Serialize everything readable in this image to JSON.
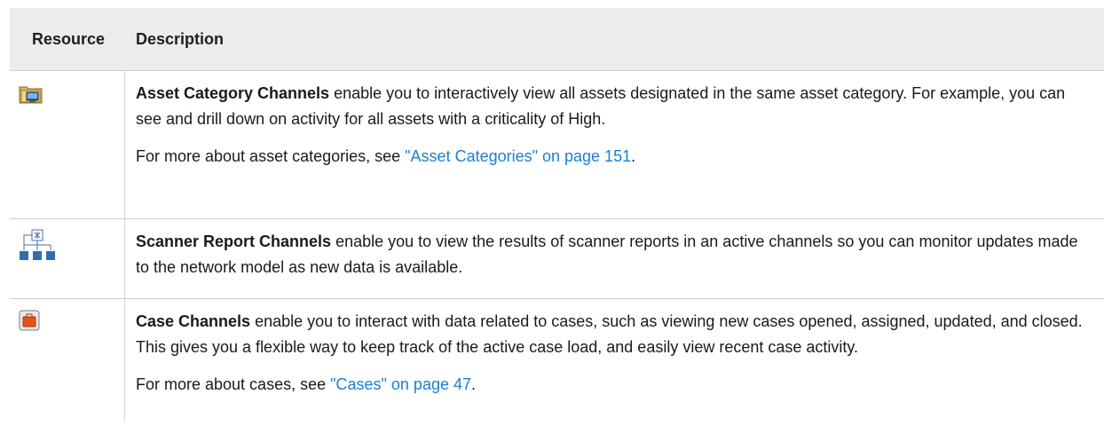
{
  "header": {
    "resource": "Resource",
    "description": "Description"
  },
  "rows": [
    {
      "icon": "asset-category-folder-icon",
      "title": "Asset Category Channels",
      "text": " enable you to interactively view all assets designated in the same asset category. For example, you can see and drill down on activity for all assets with a criticality of High.",
      "more_prefix": "For more about asset categories, see ",
      "link": "\"Asset Categories\" on page 151",
      "more_suffix": "."
    },
    {
      "icon": "scanner-report-icon",
      "title": "Scanner Report Channels",
      "text": " enable you to view the results of scanner reports in an active channels so you can monitor updates made to the network model as new data is available."
    },
    {
      "icon": "case-icon",
      "title": "Case Channels",
      "text": " enable you to interact with data related to cases, such as viewing new cases opened, assigned, updated, and closed. This gives you a flexible way to keep track of the active case load, and easily view recent case activity.",
      "more_prefix": "For more about cases, see ",
      "link": "\"Cases\" on page 47",
      "more_suffix": "."
    }
  ],
  "colors": {
    "header_bg": "#ececec",
    "link": "#1a7fd4",
    "border": "#cfcfcf"
  }
}
